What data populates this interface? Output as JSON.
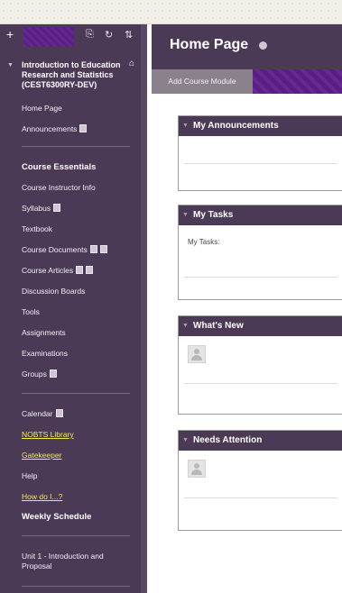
{
  "sidebar": {
    "course_title": "Introduction to Education Research and Statistics (CEST6300RY-DEV)",
    "top_items": [
      "Home Page",
      "Announcements"
    ],
    "course_essentials_heading": "Course Essentials",
    "essentials_items": [
      "Course Instructor Info",
      "Syllabus",
      "Textbook",
      "Course Documents",
      "Course Articles",
      "Discussion Boards",
      "Tools",
      "Assignments",
      "Examinations",
      "Groups"
    ],
    "lower_items": [
      "Calendar",
      "NOBTS Library",
      "Gatekeeper",
      "Help",
      "How do I...?"
    ],
    "weekly_heading": "Weekly Schedule",
    "unit_item": "Unit 1 - Introduction and Proposal",
    "toolbar": {
      "add_icon": "+",
      "copy_icon": "⎘",
      "refresh_icon": "↻",
      "sort_icon": "⇅"
    }
  },
  "header": {
    "title": "Home Page"
  },
  "subbar": {
    "tab_label": "Add Course Module"
  },
  "modules": {
    "announcements": {
      "title": "My Announcements"
    },
    "tasks": {
      "title": "My Tasks",
      "body": "My Tasks:"
    },
    "whats_new": {
      "title": "What's New"
    },
    "needs_attention": {
      "title": "Needs Attention"
    }
  },
  "colors": {
    "sidebar": "#4a3a56",
    "accent": "#5a1d86",
    "link": "#f5e94a"
  }
}
